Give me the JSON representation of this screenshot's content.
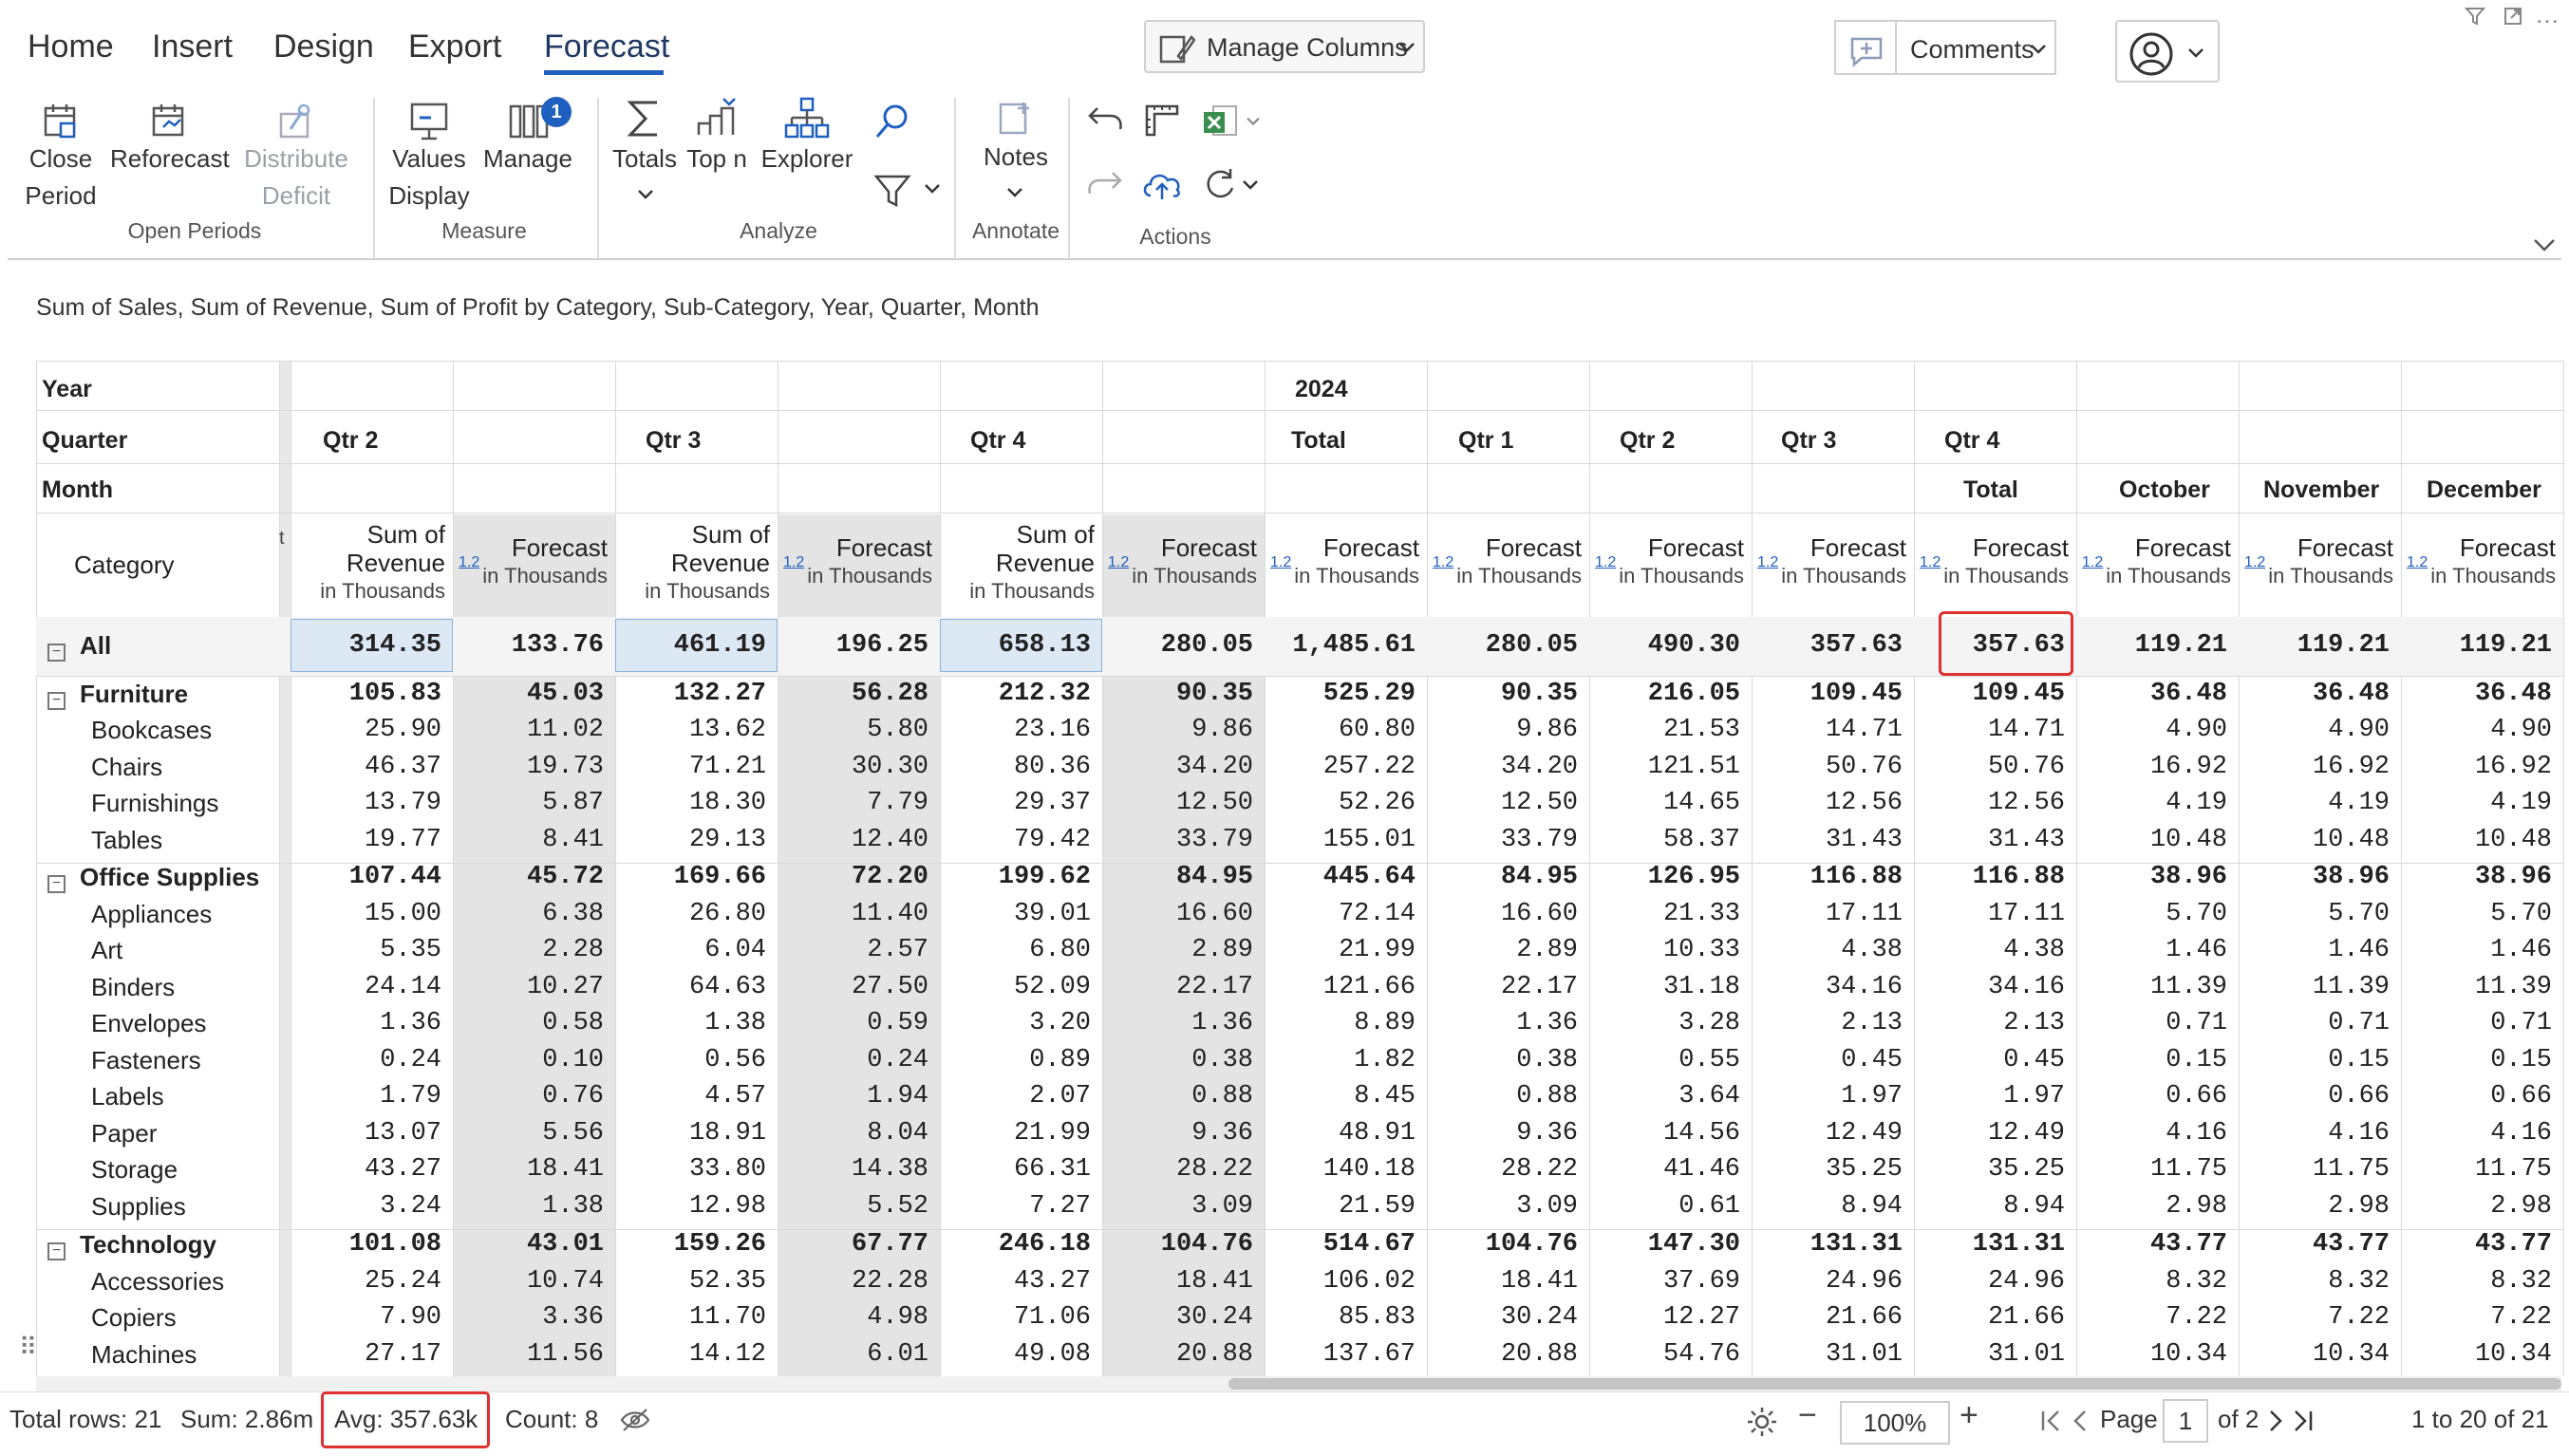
{
  "ribbon": {
    "tabs": [
      "Home",
      "Insert",
      "Design",
      "Export",
      "Forecast"
    ],
    "active_tab": "Forecast",
    "manage_columns": "Manage Columns",
    "comments": "Comments",
    "buttons": {
      "close_period_1": "Close",
      "close_period_2": "Period",
      "reforecast": "Reforecast",
      "distribute_1": "Distribute",
      "distribute_2": "Deficit",
      "values_1": "Values",
      "values_2": "Display",
      "manage": "Manage",
      "manage_badge": "1",
      "totals": "Totals",
      "topn": "Top n",
      "explorer": "Explorer",
      "notes": "Notes"
    },
    "groups": {
      "open_periods": "Open Periods",
      "measure": "Measure",
      "analyze": "Analyze",
      "annotate": "Annotate",
      "actions": "Actions"
    }
  },
  "subtitle": "Sum of Sales, Sum of Revenue, Sum of Profit by Category, Sub-Category, Year, Quarter, Month",
  "header": {
    "year_label": "Year",
    "quarter_label": "Quarter",
    "month_label": "Month",
    "category_label": "Category",
    "year_2024": "2024",
    "q_left": [
      "Qtr 2",
      "Qtr 3",
      "Qtr 4"
    ],
    "total": "Total",
    "q_right": [
      "Qtr 1",
      "Qtr 2",
      "Qtr 3"
    ],
    "qtr4": "Qtr 4",
    "months": [
      "Total",
      "October",
      "November",
      "December"
    ],
    "sum_of": "Sum of",
    "revenue": "Revenue",
    "in_thousands": "in Thousands",
    "forecast": "Forecast",
    "tag": "1.2"
  },
  "rows": [
    {
      "label": "All",
      "level": 0,
      "bold": true,
      "values": [
        "314.35",
        "133.76",
        "461.19",
        "196.25",
        "658.13",
        "280.05",
        "1,485.61",
        "280.05",
        "490.30",
        "357.63",
        "357.63",
        "119.21",
        "119.21",
        "119.21"
      ]
    },
    {
      "label": "Furniture",
      "level": 1,
      "bold": true,
      "values": [
        "105.83",
        "45.03",
        "132.27",
        "56.28",
        "212.32",
        "90.35",
        "525.29",
        "90.35",
        "216.05",
        "109.45",
        "109.45",
        "36.48",
        "36.48",
        "36.48"
      ]
    },
    {
      "label": "Bookcases",
      "level": 2,
      "bold": false,
      "values": [
        "25.90",
        "11.02",
        "13.62",
        "5.80",
        "23.16",
        "9.86",
        "60.80",
        "9.86",
        "21.53",
        "14.71",
        "14.71",
        "4.90",
        "4.90",
        "4.90"
      ]
    },
    {
      "label": "Chairs",
      "level": 2,
      "bold": false,
      "values": [
        "46.37",
        "19.73",
        "71.21",
        "30.30",
        "80.36",
        "34.20",
        "257.22",
        "34.20",
        "121.51",
        "50.76",
        "50.76",
        "16.92",
        "16.92",
        "16.92"
      ]
    },
    {
      "label": "Furnishings",
      "level": 2,
      "bold": false,
      "values": [
        "13.79",
        "5.87",
        "18.30",
        "7.79",
        "29.37",
        "12.50",
        "52.26",
        "12.50",
        "14.65",
        "12.56",
        "12.56",
        "4.19",
        "4.19",
        "4.19"
      ]
    },
    {
      "label": "Tables",
      "level": 2,
      "bold": false,
      "values": [
        "19.77",
        "8.41",
        "29.13",
        "12.40",
        "79.42",
        "33.79",
        "155.01",
        "33.79",
        "58.37",
        "31.43",
        "31.43",
        "10.48",
        "10.48",
        "10.48"
      ]
    },
    {
      "label": "Office Supplies",
      "level": 1,
      "bold": true,
      "values": [
        "107.44",
        "45.72",
        "169.66",
        "72.20",
        "199.62",
        "84.95",
        "445.64",
        "84.95",
        "126.95",
        "116.88",
        "116.88",
        "38.96",
        "38.96",
        "38.96"
      ]
    },
    {
      "label": "Appliances",
      "level": 2,
      "bold": false,
      "values": [
        "15.00",
        "6.38",
        "26.80",
        "11.40",
        "39.01",
        "16.60",
        "72.14",
        "16.60",
        "21.33",
        "17.11",
        "17.11",
        "5.70",
        "5.70",
        "5.70"
      ]
    },
    {
      "label": "Art",
      "level": 2,
      "bold": false,
      "values": [
        "5.35",
        "2.28",
        "6.04",
        "2.57",
        "6.80",
        "2.89",
        "21.99",
        "2.89",
        "10.33",
        "4.38",
        "4.38",
        "1.46",
        "1.46",
        "1.46"
      ]
    },
    {
      "label": "Binders",
      "level": 2,
      "bold": false,
      "values": [
        "24.14",
        "10.27",
        "64.63",
        "27.50",
        "52.09",
        "22.17",
        "121.66",
        "22.17",
        "31.18",
        "34.16",
        "34.16",
        "11.39",
        "11.39",
        "11.39"
      ]
    },
    {
      "label": "Envelopes",
      "level": 2,
      "bold": false,
      "values": [
        "1.36",
        "0.58",
        "1.38",
        "0.59",
        "3.20",
        "1.36",
        "8.89",
        "1.36",
        "3.28",
        "2.13",
        "2.13",
        "0.71",
        "0.71",
        "0.71"
      ]
    },
    {
      "label": "Fasteners",
      "level": 2,
      "bold": false,
      "values": [
        "0.24",
        "0.10",
        "0.56",
        "0.24",
        "0.89",
        "0.38",
        "1.82",
        "0.38",
        "0.55",
        "0.45",
        "0.45",
        "0.15",
        "0.15",
        "0.15"
      ]
    },
    {
      "label": "Labels",
      "level": 2,
      "bold": false,
      "values": [
        "1.79",
        "0.76",
        "4.57",
        "1.94",
        "2.07",
        "0.88",
        "8.45",
        "0.88",
        "3.64",
        "1.97",
        "1.97",
        "0.66",
        "0.66",
        "0.66"
      ]
    },
    {
      "label": "Paper",
      "level": 2,
      "bold": false,
      "values": [
        "13.07",
        "5.56",
        "18.91",
        "8.04",
        "21.99",
        "9.36",
        "48.91",
        "9.36",
        "14.56",
        "12.49",
        "12.49",
        "4.16",
        "4.16",
        "4.16"
      ]
    },
    {
      "label": "Storage",
      "level": 2,
      "bold": false,
      "values": [
        "43.27",
        "18.41",
        "33.80",
        "14.38",
        "66.31",
        "28.22",
        "140.18",
        "28.22",
        "41.46",
        "35.25",
        "35.25",
        "11.75",
        "11.75",
        "11.75"
      ]
    },
    {
      "label": "Supplies",
      "level": 2,
      "bold": false,
      "values": [
        "3.24",
        "1.38",
        "12.98",
        "5.52",
        "7.27",
        "3.09",
        "21.59",
        "3.09",
        "0.61",
        "8.94",
        "8.94",
        "2.98",
        "2.98",
        "2.98"
      ]
    },
    {
      "label": "Technology",
      "level": 1,
      "bold": true,
      "values": [
        "101.08",
        "43.01",
        "159.26",
        "67.77",
        "246.18",
        "104.76",
        "514.67",
        "104.76",
        "147.30",
        "131.31",
        "131.31",
        "43.77",
        "43.77",
        "43.77"
      ]
    },
    {
      "label": "Accessories",
      "level": 2,
      "bold": false,
      "values": [
        "25.24",
        "10.74",
        "52.35",
        "22.28",
        "43.27",
        "18.41",
        "106.02",
        "18.41",
        "37.69",
        "24.96",
        "24.96",
        "8.32",
        "8.32",
        "8.32"
      ]
    },
    {
      "label": "Copiers",
      "level": 2,
      "bold": false,
      "values": [
        "7.90",
        "3.36",
        "11.70",
        "4.98",
        "71.06",
        "30.24",
        "85.83",
        "30.24",
        "12.27",
        "21.66",
        "21.66",
        "7.22",
        "7.22",
        "7.22"
      ]
    },
    {
      "label": "Machines",
      "level": 2,
      "bold": false,
      "values": [
        "27.17",
        "11.56",
        "14.12",
        "6.01",
        "49.08",
        "20.88",
        "137.67",
        "20.88",
        "54.76",
        "31.01",
        "31.01",
        "10.34",
        "10.34",
        "10.34"
      ]
    }
  ],
  "status": {
    "total_rows": "Total rows: 21",
    "sum": "Sum: 2.86m",
    "avg": "Avg: 357.63k",
    "count": "Count: 8",
    "zoom": "100%",
    "page_label": "Page",
    "page_value": "1",
    "page_of": "of 2",
    "range": "1 to 20 of 21"
  },
  "colors": {
    "accent": "#1f5fbf",
    "highlight": "#e03030",
    "selected_bg": "#dde8f5",
    "forecast_bg": "#e4e4e4"
  }
}
